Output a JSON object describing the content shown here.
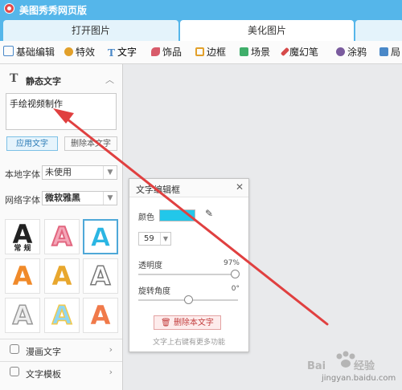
{
  "app": {
    "title": "美图秀秀网页版"
  },
  "tabs": [
    {
      "label": "打开图片"
    },
    {
      "label": "美化图片"
    }
  ],
  "toolbar": [
    {
      "label": "基础编辑",
      "icon": "edit-icon",
      "color": "#4a88c8"
    },
    {
      "label": "特效",
      "icon": "magic-wand-icon",
      "color": "#e2a02a"
    },
    {
      "label": "文字",
      "icon": "text-icon",
      "color": "#4a88c8"
    },
    {
      "label": "饰品",
      "icon": "bow-icon",
      "color": "#d85b6a"
    },
    {
      "label": "边框",
      "icon": "frame-icon",
      "color": "#e2a02a"
    },
    {
      "label": "场景",
      "icon": "scene-icon",
      "color": "#3fae6a"
    },
    {
      "label": "魔幻笔",
      "icon": "magic-pen-icon",
      "color": "#d64a4a"
    },
    {
      "label": "涂鸦",
      "icon": "brush-icon",
      "color": "#7a5b9e"
    },
    {
      "label": "局",
      "icon": "partial-icon",
      "color": "#4a88c8"
    }
  ],
  "panel": {
    "section_title": "静态文字",
    "text_content": "手绘视频制作",
    "apply_button": "应用文字",
    "delete_button": "删除本文字",
    "local_font_label": "本地字体",
    "local_font_value": "未使用",
    "web_font_label": "网络字体",
    "web_font_value": "微软雅黑",
    "style_first_caption": "常 规",
    "bottom_items": [
      {
        "label": "漫画文字"
      },
      {
        "label": "文字模板"
      }
    ]
  },
  "dialog": {
    "title": "文字编辑框",
    "color_label": "颜色",
    "color_value": "#22c7ea",
    "size_value": "59",
    "opacity_label": "透明度",
    "opacity_value": "97%",
    "opacity_level": 0.97,
    "rotation_label": "旋转角度",
    "rotation_value": "0°",
    "rotation_level": 0.5,
    "delete_button": "删除本文字",
    "hint": "文字上右键有更多功能"
  },
  "colors": {
    "accent": "#55b6ea",
    "annotation_arrow": "#e04040"
  },
  "watermark": {
    "text": "Baidu 经验",
    "url_text": "jingyan.baidu.com"
  }
}
